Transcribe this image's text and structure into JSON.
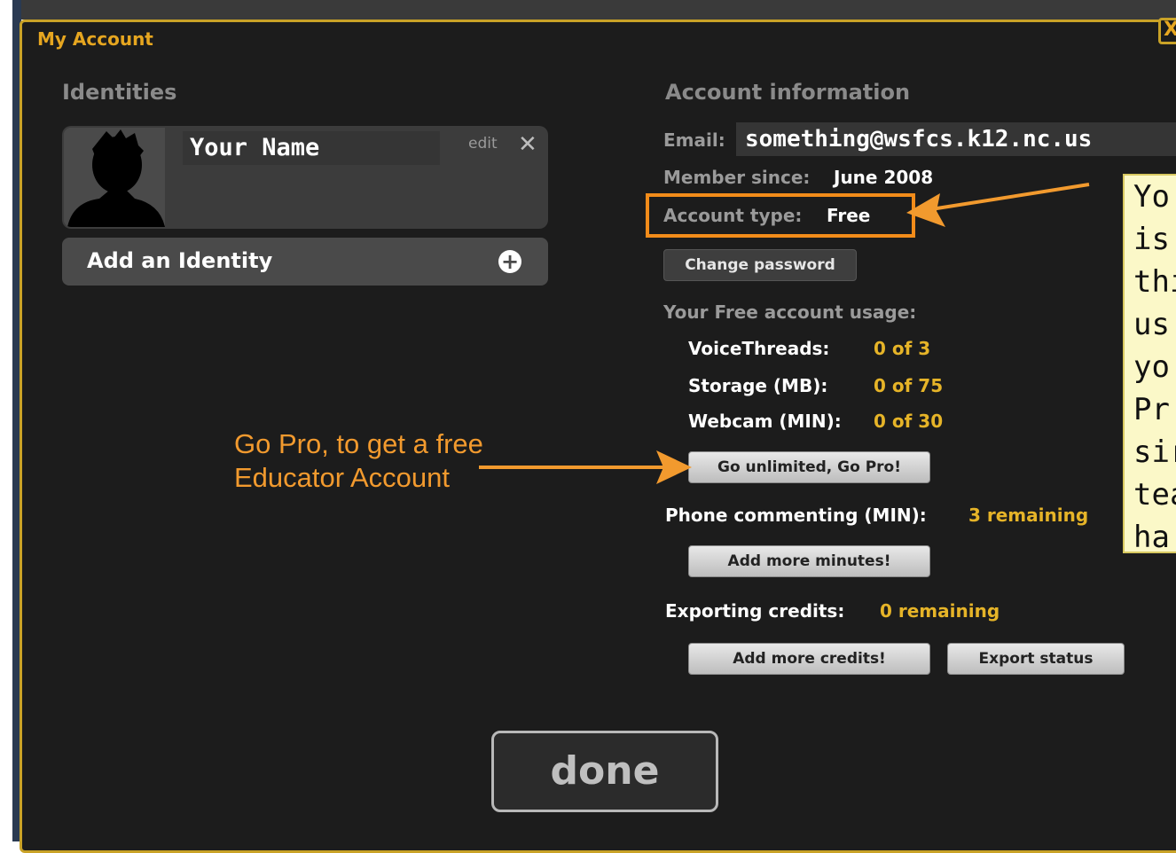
{
  "dialog": {
    "title": "My Account",
    "close_glyph": "X"
  },
  "identities": {
    "heading": "Identities",
    "card": {
      "name": "Your Name",
      "edit_label": "edit",
      "remove_glyph": "✕",
      "avatar_icon": "silhouette-avatar-icon"
    },
    "add_label": "Add an Identity",
    "add_icon": "plus-circle-icon"
  },
  "account": {
    "heading": "Account information",
    "email_label": "Email:",
    "email_value": "something@wsfcs.k12.nc.us",
    "member_label": "Member since:",
    "member_value": "June 2008",
    "type_label": "Account type:",
    "type_value": "Free",
    "change_password": "Change password",
    "usage_heading": "Your Free account usage:",
    "usage": [
      {
        "label": "VoiceThreads:",
        "value": "0 of 3"
      },
      {
        "label": "Storage (MB):",
        "value": "0 of 75"
      },
      {
        "label": "Webcam (MIN):",
        "value": "0 of 30"
      }
    ],
    "go_pro": "Go unlimited, Go Pro!",
    "phone_label": "Phone commenting (MIN):",
    "phone_value": "3 remaining",
    "add_minutes": "Add more minutes!",
    "export_label": "Exporting credits:",
    "export_value": "0 remaining",
    "add_credits": "Add more credits!",
    "export_status": "Export status"
  },
  "done_label": "done",
  "annotations": {
    "orange_line1": "Go Pro, to get a free",
    "orange_line2": "Educator Account",
    "callout_lines": [
      "Yo",
      "is",
      "thi",
      "us",
      "yo",
      "Pr",
      "sir",
      "tea",
      "ha"
    ]
  },
  "colors": {
    "accent": "#e6a620",
    "highlight": "#f28c1a",
    "panel": "#1c1c1c"
  }
}
